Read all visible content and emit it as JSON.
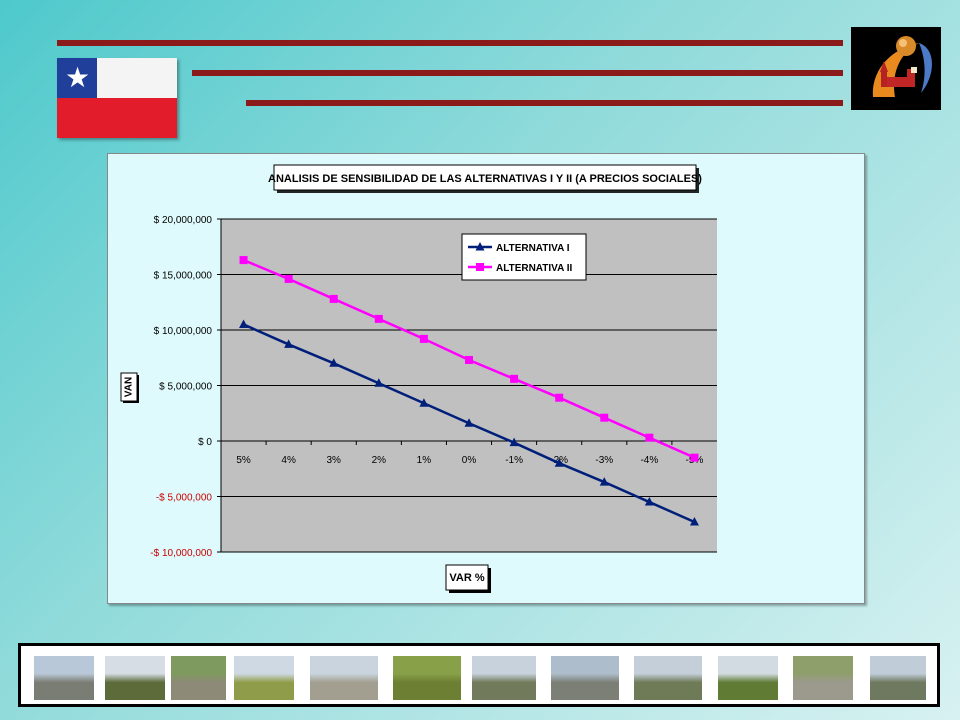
{
  "colors": {
    "rule": "#8b1a1a",
    "series1": "#001f7a",
    "series2": "#ff00ff",
    "plot_bg": "#c0c0c0",
    "chart_bg": "#dffafc",
    "negative_ticks": "#cc0000"
  },
  "icons": {
    "flag": "chile-flag-icon",
    "logo": "municipal-logo-icon"
  },
  "chart_data": {
    "type": "line",
    "title": "ANALISIS DE SENSIBILIDAD DE LAS ALTERNATIVAS I Y II (A PRECIOS SOCIALES)",
    "xlabel": "VAR %",
    "ylabel": "VAN",
    "categories": [
      "5%",
      "4%",
      "3%",
      "2%",
      "1%",
      "0%",
      "-1%",
      "-2%",
      "-3%",
      "-4%",
      "-5%"
    ],
    "series": [
      {
        "name": "ALTERNATIVA I",
        "marker": "triangle",
        "values": [
          10500000,
          8700000,
          7000000,
          5200000,
          3400000,
          1600000,
          -150000,
          -2000000,
          -3700000,
          -5500000,
          -7300000
        ]
      },
      {
        "name": "ALTERNATIVA II",
        "marker": "square",
        "values": [
          16300000,
          14600000,
          12800000,
          11000000,
          9200000,
          7300000,
          5600000,
          3900000,
          2100000,
          300000,
          -1500000
        ]
      }
    ],
    "ylim": [
      -10000000,
      20000000
    ],
    "yticks": [
      20000000,
      15000000,
      10000000,
      5000000,
      0,
      -5000000,
      -10000000
    ],
    "ytick_labels": [
      "$ 20,000,000",
      "$ 15,000,000",
      "$ 10,000,000",
      "$ 5,000,000",
      "$ 0",
      "-$ 5,000,000",
      "-$ 10,000,000"
    ],
    "grid": true,
    "legend_position": "top-right"
  },
  "thumbnails": [
    {
      "name": "thumb-riverbed",
      "sky": "#b9c8d8",
      "ground": "#7a7d73"
    },
    {
      "name": "thumb-trees",
      "sky": "#d6dde4",
      "ground": "#5d6b3a"
    },
    {
      "name": "thumb-bridge-stone",
      "sky": "#7f9a5e",
      "ground": "#8d8a78"
    },
    {
      "name": "thumb-path",
      "sky": "#cfd9e3",
      "ground": "#8f9d4a"
    },
    {
      "name": "thumb-rubble",
      "sky": "#c9d4de",
      "ground": "#a39f90"
    },
    {
      "name": "thumb-grass",
      "sky": "#88a048",
      "ground": "#6d7f32"
    },
    {
      "name": "thumb-poplars",
      "sky": "#c7d2dc",
      "ground": "#717a5a"
    },
    {
      "name": "thumb-highway-bridge",
      "sky": "#aebdcc",
      "ground": "#7c7f76"
    },
    {
      "name": "thumb-channel",
      "sky": "#c4cfd9",
      "ground": "#6f7a57"
    },
    {
      "name": "thumb-willow",
      "sky": "#d3dbe2",
      "ground": "#5f7b34"
    },
    {
      "name": "thumb-stones",
      "sky": "#8f9f6c",
      "ground": "#9b9a8c"
    },
    {
      "name": "thumb-river",
      "sky": "#c0cdd9",
      "ground": "#6e7960"
    }
  ]
}
